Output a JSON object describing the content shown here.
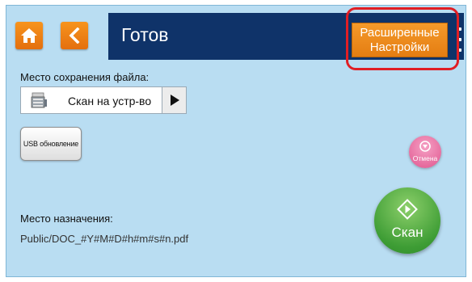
{
  "header": {
    "title": "Готов",
    "advanced_line1": "Расширенные",
    "advanced_line2": "Настройки"
  },
  "icons": {
    "home": "home-icon",
    "back": "chevron-left-icon",
    "more": "kebab-menu-icon",
    "device": "printer-icon",
    "next": "play-arrow-icon",
    "cancel": "arrow-down-circle-icon",
    "scan": "diamond-start-icon"
  },
  "save_location": {
    "label": "Место сохранения файла:",
    "value": "Скан на устр-во"
  },
  "usb_button": {
    "label": "USB обновление"
  },
  "cancel_button": {
    "label": "Отмена"
  },
  "scan_button": {
    "label": "Скан"
  },
  "destination": {
    "label": "Место назначения:",
    "path": "Public/DOC_#Y#M#D#h#m#s#n.pdf"
  },
  "colors": {
    "background": "#b9ddf2",
    "title_bar": "#0f3369",
    "orange": "#f28a1d",
    "highlight": "#e01e24",
    "cancel": "#e0568f",
    "scan": "#3e9d35"
  }
}
